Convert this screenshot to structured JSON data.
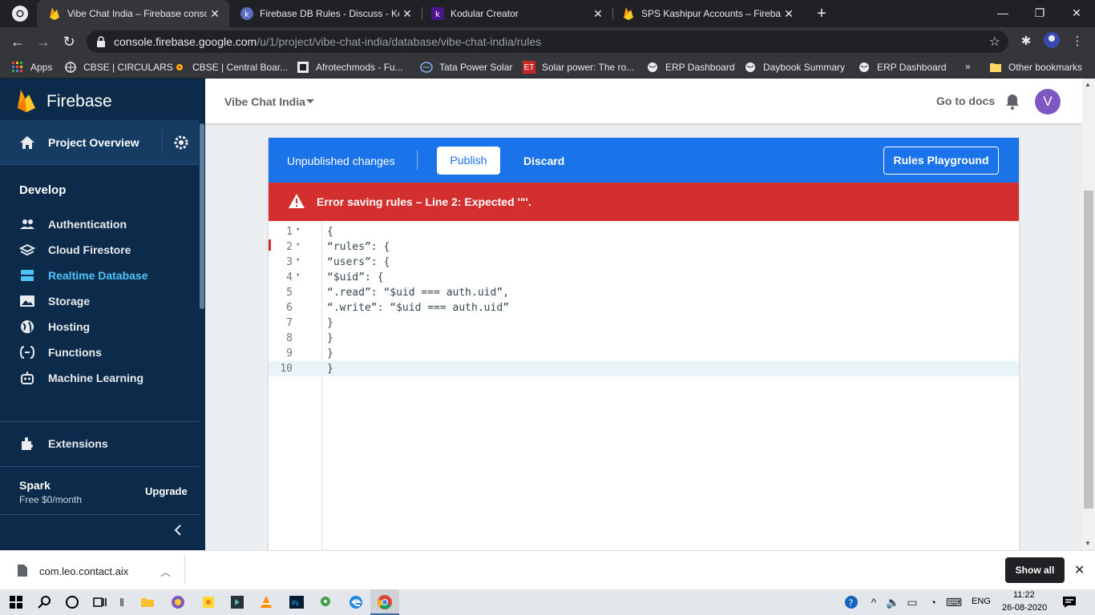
{
  "browser": {
    "tabs": [
      {
        "title": "Vibe Chat India – Firebase console",
        "active": true,
        "close": "✕"
      },
      {
        "title": "Firebase DB Rules - Discuss - Kodular",
        "active": false,
        "close": "✕"
      },
      {
        "title": "Kodular Creator",
        "active": false,
        "close": "✕"
      },
      {
        "title": "SPS Kashipur Accounts – Firebase console",
        "active": false,
        "close": "✕"
      }
    ],
    "url_host": "console.firebase.google.com",
    "url_path": "/u/1/project/vibe-chat-india/database/vibe-chat-india/rules",
    "bookmarks": [
      {
        "label": "Apps"
      },
      {
        "label": "CBSE | CIRCULARS"
      },
      {
        "label": "CBSE | Central Boar..."
      },
      {
        "label": "Afrotechmods - Fu..."
      },
      {
        "label": "Tata Power Solar"
      },
      {
        "label": "Solar power: The ro..."
      },
      {
        "label": "ERP Dashboard"
      },
      {
        "label": "Daybook Summary"
      },
      {
        "label": "ERP Dashboard"
      }
    ],
    "bookmarks_overflow": "»",
    "other_bookmarks": "Other bookmarks"
  },
  "sidebar": {
    "brand": "Firebase",
    "project_overview": "Project Overview",
    "section": "Develop",
    "items": [
      {
        "label": "Authentication",
        "icon": "people-icon"
      },
      {
        "label": "Cloud Firestore",
        "icon": "firestore-icon"
      },
      {
        "label": "Realtime Database",
        "icon": "database-icon",
        "active": true
      },
      {
        "label": "Storage",
        "icon": "storage-icon"
      },
      {
        "label": "Hosting",
        "icon": "globe-icon"
      },
      {
        "label": "Functions",
        "icon": "functions-icon"
      },
      {
        "label": "Machine Learning",
        "icon": "robot-icon"
      }
    ],
    "extensions": "Extensions",
    "plan_name": "Spark",
    "plan_price": "Free $0/month",
    "upgrade": "Upgrade"
  },
  "topbar": {
    "project": "Vibe Chat India",
    "docs": "Go to docs",
    "avatar_letter": "V"
  },
  "rules": {
    "unpublished": "Unpublished changes",
    "publish": "Publish",
    "discard": "Discard",
    "playground": "Rules Playground",
    "error": "Error saving rules – Line 2: Expected '\"'.",
    "lines": [
      {
        "num": "1",
        "fold": "▾",
        "code": "{"
      },
      {
        "num": "2",
        "fold": "▾",
        "code": "“rules”: {"
      },
      {
        "num": "3",
        "fold": "▾",
        "code": "“users”: {"
      },
      {
        "num": "4",
        "fold": "▾",
        "code": "“$uid”: {"
      },
      {
        "num": "5",
        "fold": "",
        "code": "“.read”: “$uid === auth.uid”,"
      },
      {
        "num": "6",
        "fold": "",
        "code": "“.write”: “$uid === auth.uid”"
      },
      {
        "num": "7",
        "fold": "",
        "code": "}"
      },
      {
        "num": "8",
        "fold": "",
        "code": "}"
      },
      {
        "num": "9",
        "fold": "",
        "code": "}"
      },
      {
        "num": "10",
        "fold": "",
        "code": "}"
      }
    ]
  },
  "download": {
    "file": "com.leo.contact.aix",
    "show_all": "Show all"
  },
  "taskbar": {
    "lang": "ENG",
    "time": "11:22",
    "date": "26-08-2020"
  },
  "colors": {
    "firebase_nav": "#0c2b4b",
    "blue_bar": "#1a73e8",
    "error_red": "#d32f2f",
    "active_link": "#4fc3f7"
  }
}
